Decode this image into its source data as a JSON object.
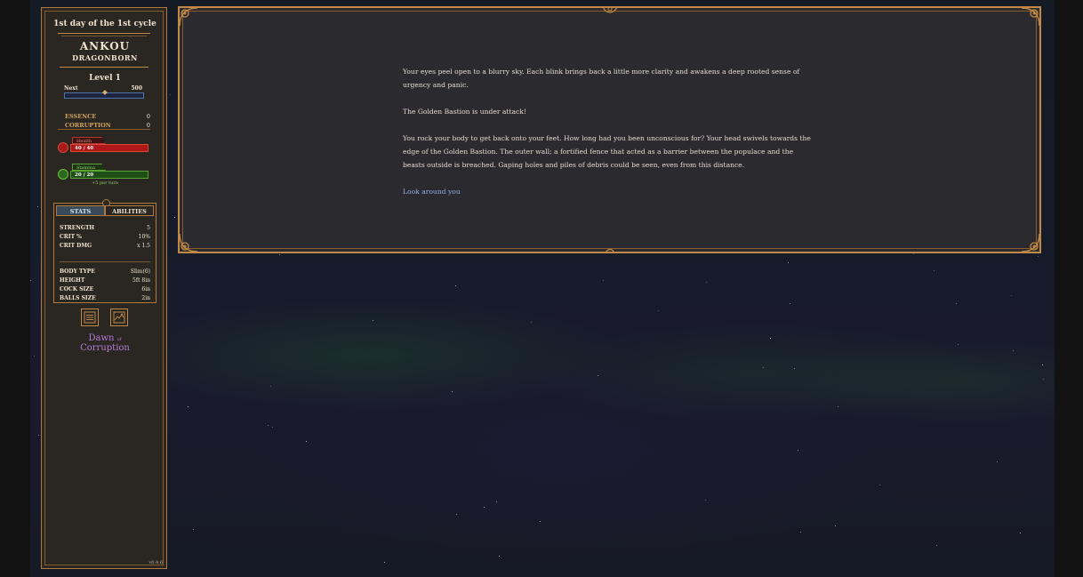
{
  "sidebar": {
    "day": "1st day of the 1st cycle",
    "name": "ANKOU",
    "race": "DRAGONBORN",
    "level": "Level 1",
    "next_label": "Next",
    "next_value": "500",
    "xp_progress": 0.0,
    "essence_label": "ESSENCE",
    "essence_value": "0",
    "corruption_label": "CORRUPTION",
    "corruption_value": "0",
    "health": {
      "label": "Health",
      "text": "40 / 40",
      "fraction": 1.0
    },
    "stamina": {
      "label": "Stamina",
      "text": "20 / 20",
      "fraction": 1.0,
      "rate": "+5 per turn"
    },
    "tabs": {
      "stats": "STATS",
      "abilities": "ABILITIES"
    },
    "stats": [
      {
        "label": "STRENGTH",
        "value": "5"
      },
      {
        "label": "CRIT %",
        "value": "10%"
      },
      {
        "label": "CRIT DMG",
        "value": "x 1.5"
      }
    ],
    "body": [
      {
        "label": "BODY TYPE",
        "value": "Slim(6)"
      },
      {
        "label": "HEIGHT",
        "value": "5ft 8in"
      },
      {
        "label": "COCK SIZE",
        "value": "6in"
      },
      {
        "label": "BALLS SIZE",
        "value": "2in"
      }
    ],
    "icons": [
      "journal-icon",
      "map-icon"
    ],
    "logo_top": "Dawn",
    "logo_of": "of",
    "logo_bottom": "Corruption",
    "version": "v0.4.6"
  },
  "panel": {
    "paragraphs": [
      "Your eyes peel open to a blurry sky. Each blink brings back a little more clarity and awakens a deep rooted sense of urgency and panic.",
      "The Golden Bastion is under attack!",
      "You rock your body to get back onto your feet. How long had you been unconscious for? Your head swivels towards the edge of the Golden Bastion. The outer wall; a fortified fence that acted as a barrier between the populace and the beasts outside is breached. Gaping holes and piles of debris could be seen, even from this distance."
    ],
    "action_link": "Look around you"
  },
  "colors": {
    "gold_border": "#c08a46",
    "health_red": "#b01818",
    "stamina_green": "#1e4e16",
    "link_blue": "#8fb0e8",
    "logo_purple": "#b87bd6"
  }
}
